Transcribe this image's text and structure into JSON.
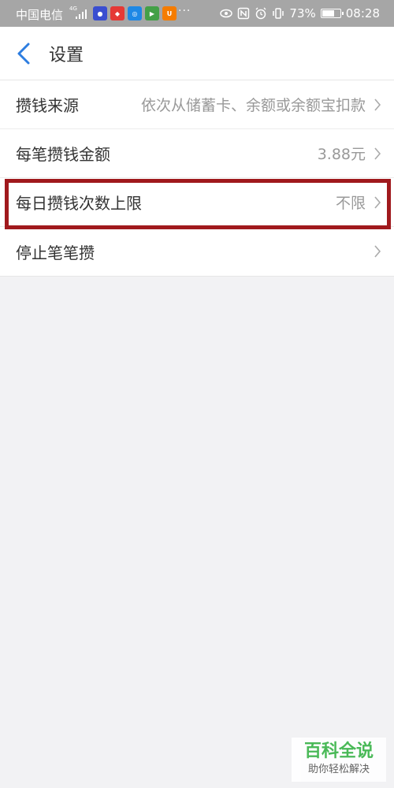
{
  "status_bar": {
    "carrier": "中国电信",
    "network": "4G",
    "battery": "73%",
    "battery_level": 0.73,
    "time": "08:28",
    "more": "···",
    "app_icon_colors": [
      "#3a4ed0",
      "#e53935",
      "#1e88e5",
      "#43a047",
      "#f57c00"
    ]
  },
  "header": {
    "title": "设置",
    "back_icon": "chevron-left-icon",
    "accent_color": "#2d7de0"
  },
  "settings": [
    {
      "label": "攒钱来源",
      "value": "依次从储蓄卡、余额或余额宝扣款",
      "highlighted": false
    },
    {
      "label": "每笔攒钱金额",
      "value": "3.88元",
      "highlighted": false
    },
    {
      "label": "每日攒钱次数上限",
      "value": "不限",
      "highlighted": true
    },
    {
      "label": "停止笔笔攒",
      "value": "",
      "highlighted": false
    }
  ],
  "watermark": {
    "title": "百科全说",
    "subtitle": "助你轻松解决"
  }
}
